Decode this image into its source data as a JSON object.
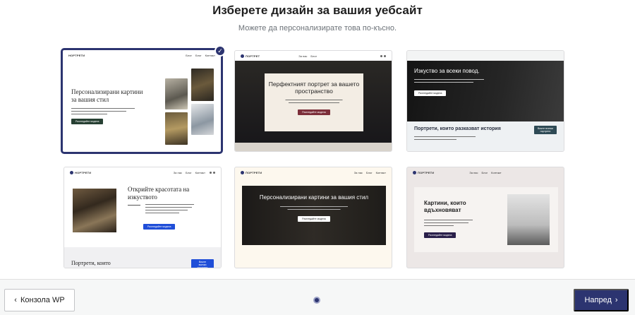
{
  "header": {
    "title": "Изберете дизайн за вашия уебсайт",
    "subtitle": "Можете да персонализирате това по-късно."
  },
  "designs": [
    {
      "logo": "НОРТРЕТИ",
      "nav": [
        "Блог",
        "Блог",
        "Контакт"
      ],
      "heading": "Персонализирани картини за вашия стил",
      "button": "Разгледайте модела",
      "selected": true
    },
    {
      "logo": "ПОРТРЕТ",
      "nav": [
        "За нас",
        "Блог"
      ],
      "heading": "Перфектният портрет за вашето пространство",
      "button": "Разгледайте модела"
    },
    {
      "logo": "",
      "nav": [],
      "heading": "Изкуство за всеки повод.",
      "heading2": "Портрети, които разказват история",
      "button": "Разгледайте модела",
      "button2": "Вижте всички портрети"
    },
    {
      "logo": "НОРТРЕТИ",
      "nav": [
        "За нас",
        "Блог",
        "Контакт"
      ],
      "heading": "Открийте красотата на изкуството",
      "heading2": "Портрети, които",
      "button": "Разгледайте модела",
      "button2": "Вижте всички портрети"
    },
    {
      "logo": "ПОРТРЕТИ",
      "nav": [
        "За нас",
        "Блог",
        "Контакт"
      ],
      "heading": "Персонализирани картини за вашия стил",
      "button": "Разгледайте модела"
    },
    {
      "logo": "ПОРТРЕТИ",
      "nav": [
        "За нас",
        "Блог",
        "Контакт"
      ],
      "heading": "Картини, които вдъхновяват",
      "button": "Разгледайте модела"
    }
  ],
  "footer": {
    "back_label": "Конзола WP",
    "next_label": "Напред",
    "back_icon": "‹",
    "next_icon": "›"
  },
  "colors": {
    "accent": "#2c3470",
    "background": "#f6f7f7"
  }
}
